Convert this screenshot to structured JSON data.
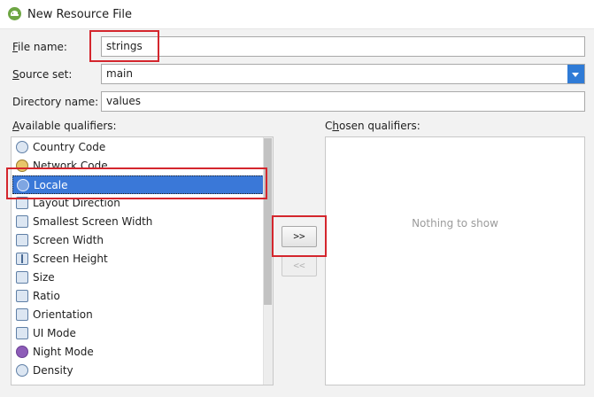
{
  "window": {
    "title": "New Resource File",
    "icon": "android-studio-icon"
  },
  "form": {
    "file_name": {
      "label_mnemonic": "F",
      "label_rest": "ile name:",
      "value": "strings"
    },
    "source_set": {
      "label_mnemonic": "S",
      "label_rest": "ource set:",
      "value": "main"
    },
    "directory_name": {
      "label": "Directory name:",
      "value": "values"
    }
  },
  "available": {
    "label_mnemonic": "A",
    "label_rest": "vailable qualifiers:",
    "items": [
      {
        "label": "Country Code",
        "icon": "globe-icon"
      },
      {
        "label": "Network Code",
        "icon": "network-icon"
      },
      {
        "label": "Locale",
        "icon": "locale-globe-icon",
        "selected": true
      },
      {
        "label": "Layout Direction",
        "icon": "layout-direction-icon"
      },
      {
        "label": "Smallest Screen Width",
        "icon": "smallest-width-icon"
      },
      {
        "label": "Screen Width",
        "icon": "screen-width-icon"
      },
      {
        "label": "Screen Height",
        "icon": "screen-height-icon"
      },
      {
        "label": "Size",
        "icon": "size-icon"
      },
      {
        "label": "Ratio",
        "icon": "ratio-icon"
      },
      {
        "label": "Orientation",
        "icon": "orientation-icon"
      },
      {
        "label": "UI Mode",
        "icon": "ui-mode-icon"
      },
      {
        "label": "Night Mode",
        "icon": "night-mode-icon"
      },
      {
        "label": "Density",
        "icon": "density-icon"
      }
    ]
  },
  "buttons": {
    "add": ">>",
    "remove": "<<"
  },
  "chosen": {
    "label_mnemonic": "h",
    "label_pre": "C",
    "label_rest": "osen qualifiers:",
    "empty_text": "Nothing to show"
  },
  "colors": {
    "selection": "#3a78d8",
    "highlight": "#d4262d",
    "combo_accent": "#2f7bd6"
  }
}
